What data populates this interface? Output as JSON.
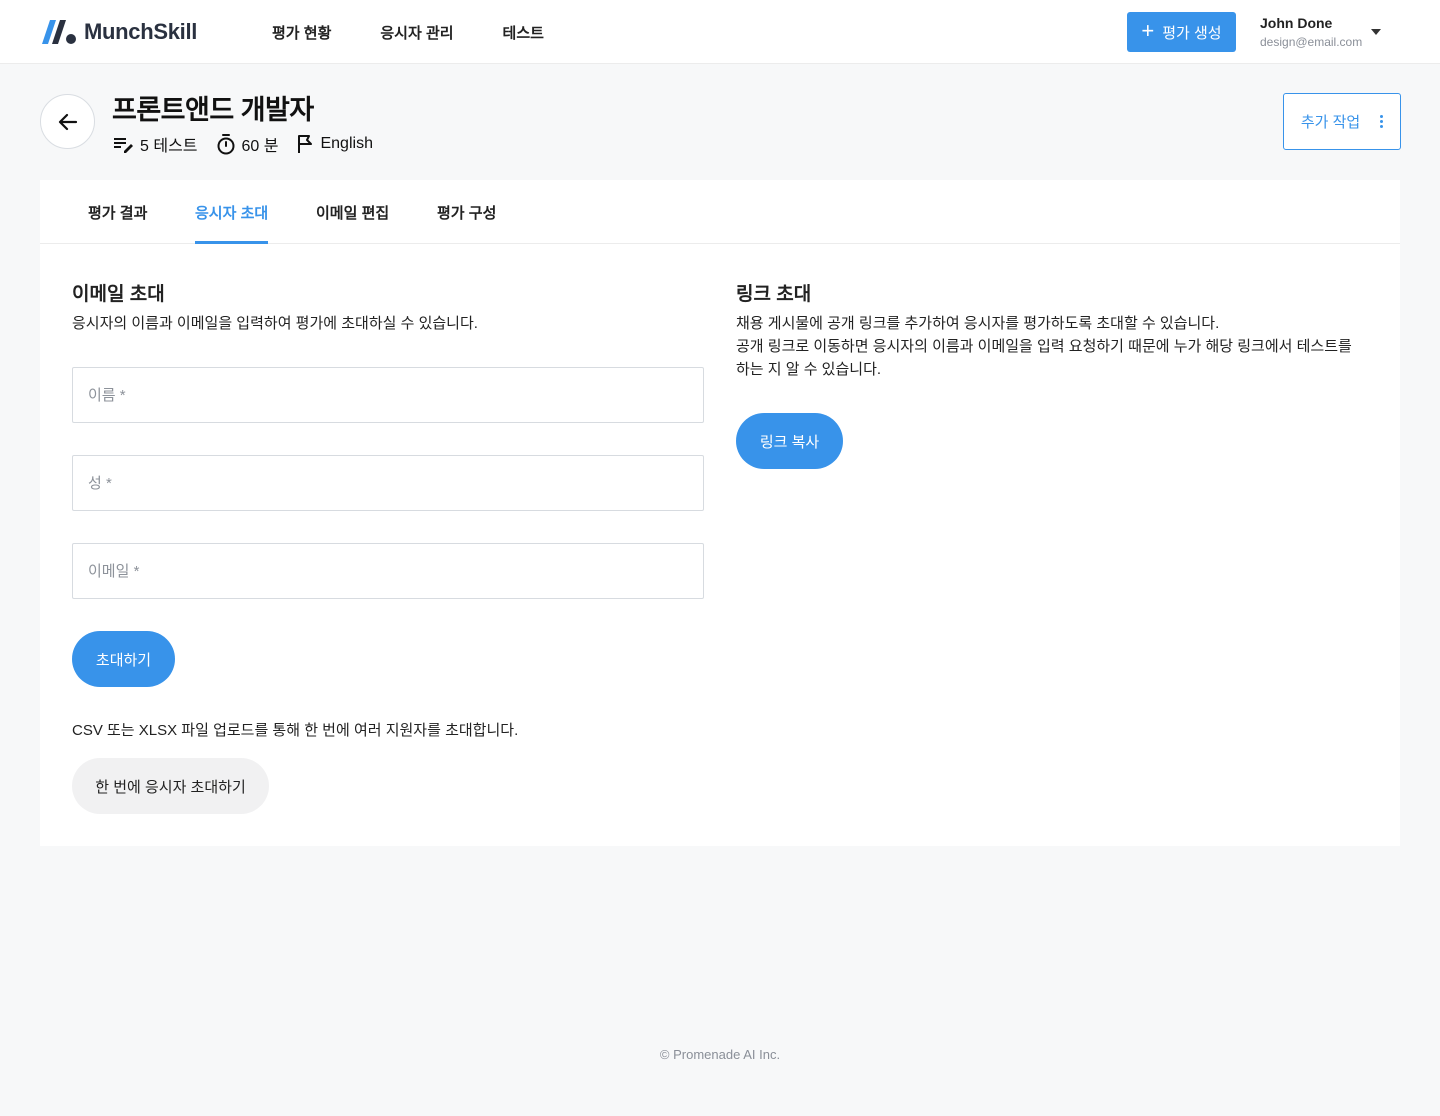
{
  "header": {
    "logo_text": "MunchSkill",
    "nav": [
      "평가 현황",
      "응시자 관리",
      "테스트"
    ],
    "create_button": "평가 생성",
    "user_name": "John Done",
    "user_email": "design@email.com"
  },
  "assessment": {
    "title": "프론트앤드 개발자",
    "tests": "5 테스트",
    "duration": "60 분",
    "language": "English",
    "more_button": "추가 작업"
  },
  "tabs": [
    "평가 결과",
    "응시자 초대",
    "이메일 편집",
    "평가 구성"
  ],
  "active_tab": "응시자 초대",
  "email_invite": {
    "title": "이메일 초대",
    "description": "응시자의 이름과 이메일을 입력하여 평가에 초대하실 수 있습니다.",
    "first_name_placeholder": "이름 *",
    "last_name_placeholder": "성 *",
    "email_placeholder": "이메일 *",
    "invite_button": "초대하기",
    "bulk_text": "CSV 또는 XLSX 파일 업로드를 통해 한 번에 여러 지원자를 초대합니다.",
    "bulk_button": "한 번에 응시자 초대하기"
  },
  "link_invite": {
    "title": "링크 초대",
    "description_line1": "채용 게시물에 공개 링크를 추가하여 응시자를 평가하도록 초대할 수 있습니다.",
    "description_line2": "공개 링크로 이동하면 응시자의 이름과 이메일을 입력 요청하기 때문에 누가 해당 링크에서 테스트를 하는 지 알 수 있습니다.",
    "copy_button": "링크 복사"
  },
  "footer": "© Promenade AI Inc.",
  "colors": {
    "accent": "#3893ea",
    "background": "#f7f8f9"
  }
}
